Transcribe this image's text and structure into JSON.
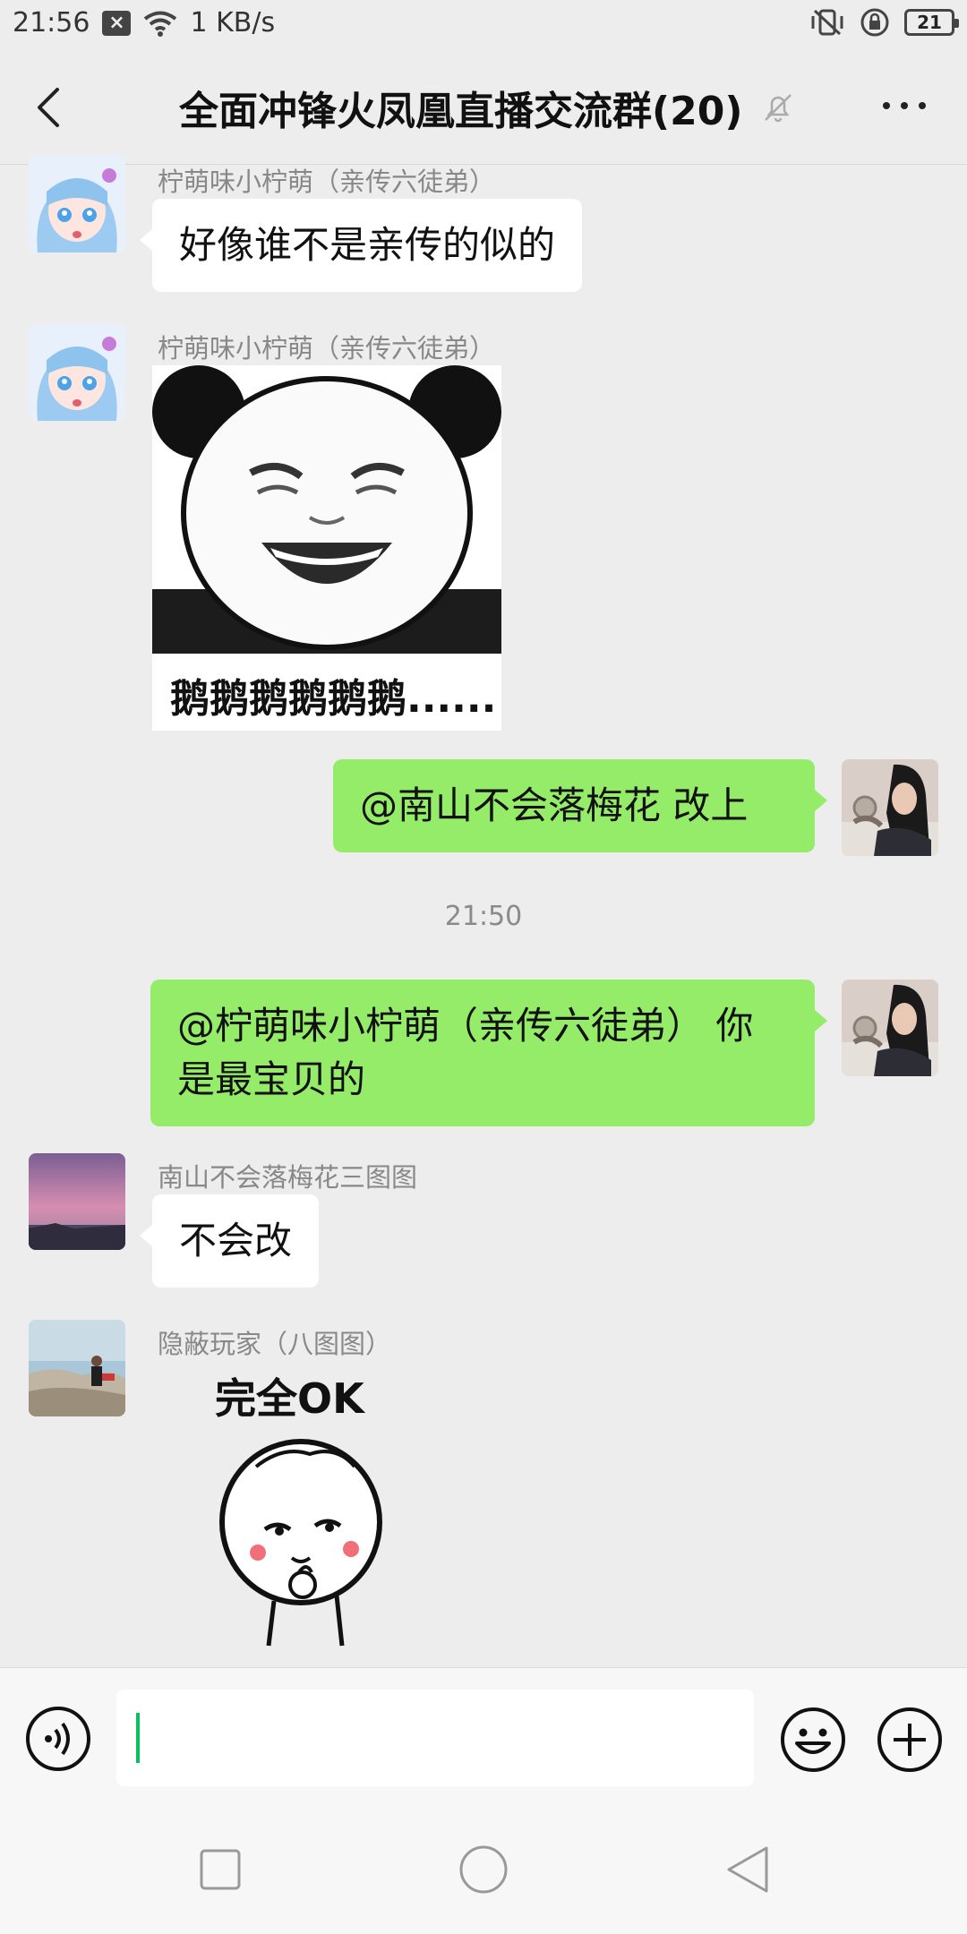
{
  "status_bar": {
    "time": "21:56",
    "notification_icon": "x-square-icon",
    "network_speed": "1 KB/s",
    "battery_level": "21"
  },
  "header": {
    "title": "全面冲锋火凤凰直播交流群(20)",
    "muted": true
  },
  "messages": [
    {
      "side": "left",
      "sender": "柠萌味小柠萌（亲传六徒弟）",
      "text": "好像谁不是亲传的似的"
    },
    {
      "side": "left",
      "sender": "柠萌味小柠萌（亲传六徒弟）",
      "sticker_caption": "鹅鹅鹅鹅鹅鹅......"
    },
    {
      "side": "right",
      "text": "@南山不会落梅花  改上"
    },
    {
      "timestamp": "21:50"
    },
    {
      "side": "right",
      "text_line1": "@柠萌味小柠萌（亲传六徒弟） 你",
      "text_line2": "是最宝贝的"
    },
    {
      "side": "left",
      "sender": "南山不会落梅花三图图",
      "text": "不会改"
    },
    {
      "side": "left",
      "sender": "隐蔽玩家（八图图）",
      "sticker_caption": "完全OK"
    }
  ],
  "input": {
    "value": "",
    "placeholder": ""
  },
  "colors": {
    "background": "#ededed",
    "bubble_self": "#95ec69",
    "bubble_other": "#ffffff",
    "cursor": "#07c160"
  }
}
